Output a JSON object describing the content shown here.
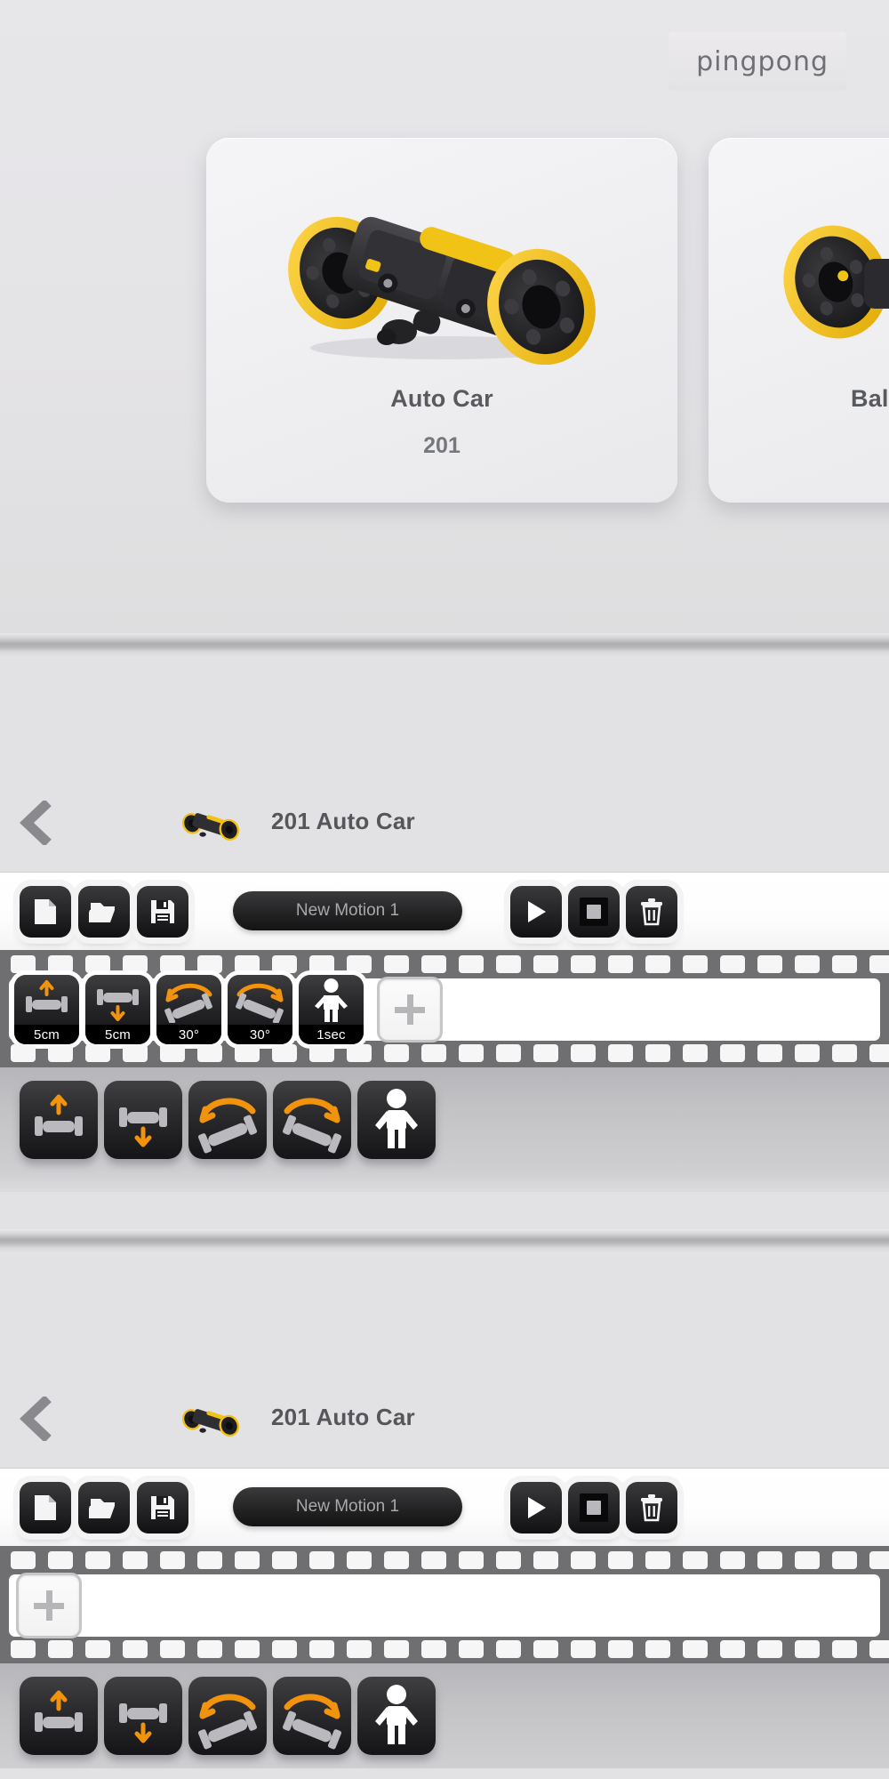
{
  "app": {
    "brand": "pingpong"
  },
  "chooser": {
    "cards": [
      {
        "name": "Auto Car",
        "number": "201",
        "art": "auto-car-robot"
      },
      {
        "name": "Balance",
        "number": "",
        "art": "balance-robot"
      }
    ]
  },
  "editors": [
    {
      "id": "editor-with-frames",
      "header": {
        "back": "back-chevron",
        "thumb": "auto-car-thumb",
        "title": "201 Auto Car"
      },
      "toolbar": {
        "new_label": "new-file",
        "open_label": "open-folder",
        "save_label": "save-disk",
        "motion_name": "New Motion 1",
        "motion_name_placeholder": "New Motion 1",
        "play_label": "play",
        "stop_label": "stop",
        "delete_label": "delete"
      },
      "timeline": {
        "add_label": "+",
        "frames": [
          {
            "icon": "move-forward-icon",
            "caption": "5cm"
          },
          {
            "icon": "move-backward-icon",
            "caption": "5cm"
          },
          {
            "icon": "turn-left-icon",
            "caption": "30°"
          },
          {
            "icon": "turn-right-icon",
            "caption": "30°"
          },
          {
            "icon": "wait-person-icon",
            "caption": "1sec"
          }
        ]
      },
      "palette": [
        {
          "icon": "move-forward-icon"
        },
        {
          "icon": "move-backward-icon"
        },
        {
          "icon": "turn-left-icon"
        },
        {
          "icon": "turn-right-icon"
        },
        {
          "icon": "wait-person-icon"
        }
      ]
    },
    {
      "id": "editor-empty",
      "header": {
        "back": "back-chevron",
        "thumb": "auto-car-thumb",
        "title": "201 Auto Car"
      },
      "toolbar": {
        "new_label": "new-file",
        "open_label": "open-folder",
        "save_label": "save-disk",
        "motion_name": "New Motion 1",
        "motion_name_placeholder": "New Motion 1",
        "play_label": "play",
        "stop_label": "stop",
        "delete_label": "delete"
      },
      "timeline": {
        "add_label": "+",
        "frames": []
      },
      "palette": [
        {
          "icon": "move-forward-icon"
        },
        {
          "icon": "move-backward-icon"
        },
        {
          "icon": "turn-left-icon"
        },
        {
          "icon": "turn-right-icon"
        },
        {
          "icon": "wait-person-icon"
        }
      ]
    }
  ],
  "colors": {
    "accent_orange": "#f2930d",
    "panel_dark": "#1b1b1d",
    "background": "#e2e1e4",
    "film_gray": "#6f6f72",
    "robot_yellow": "#f5c518"
  }
}
